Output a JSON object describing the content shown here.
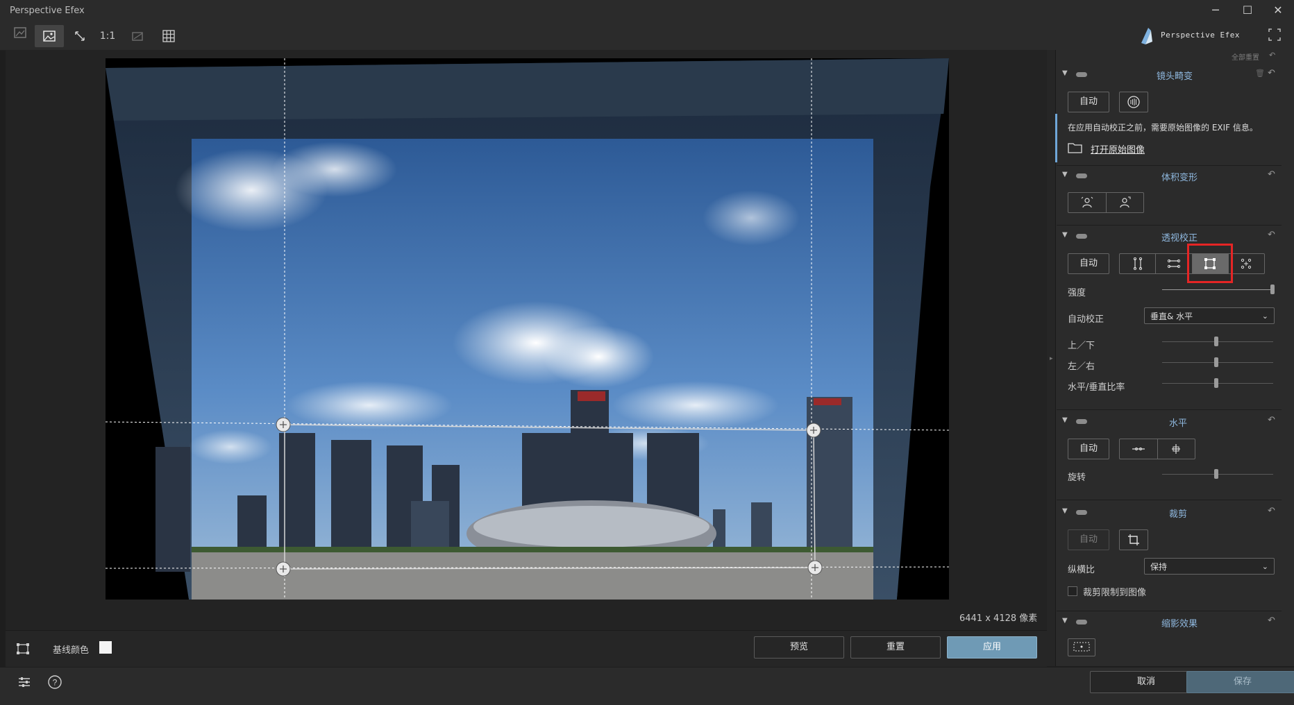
{
  "window": {
    "title": "Perspective Efex",
    "controls": [
      "─",
      "☐",
      "✕"
    ]
  },
  "toolbar": {
    "zoom_label": "1:1",
    "brand": "Perspective Efex"
  },
  "canvas": {
    "dimensions": "6441 x 4128 像素"
  },
  "canvas_bar": {
    "baseline_label": "基线颜色",
    "baseline_color": "#f4f4f4",
    "preview": "预览",
    "reset": "重置",
    "apply": "应用"
  },
  "bottom": {
    "cancel": "取消",
    "save": "保存"
  },
  "panel": {
    "reset_all": "全部重置",
    "lens": {
      "title": "镜头畸变",
      "auto": "自动",
      "info": "在应用自动校正之前，需要原始图像的 EXIF 信息。",
      "open_original": "打开原始图像"
    },
    "volume": {
      "title": "体积变形"
    },
    "perspective": {
      "title": "透视校正",
      "auto": "自动",
      "strength_label": "强度",
      "strength_value": 1.0,
      "auto_correct_label": "自动校正",
      "auto_correct_value": "垂直& 水平",
      "up_down": "上／下",
      "left_right": "左／右",
      "ratio": "水平/垂直比率",
      "up_down_value": 0.5,
      "left_right_value": 0.5,
      "ratio_value": 0.5
    },
    "horizon": {
      "title": "水平",
      "auto": "自动",
      "rotate_label": "旋转",
      "rotate_value": 0.5
    },
    "crop": {
      "title": "裁剪",
      "auto": "自动",
      "aspect_label": "纵横比",
      "aspect_value": "保持",
      "limit_label": "裁剪限制到图像"
    },
    "vignette": {
      "title": "缩影效果"
    }
  }
}
